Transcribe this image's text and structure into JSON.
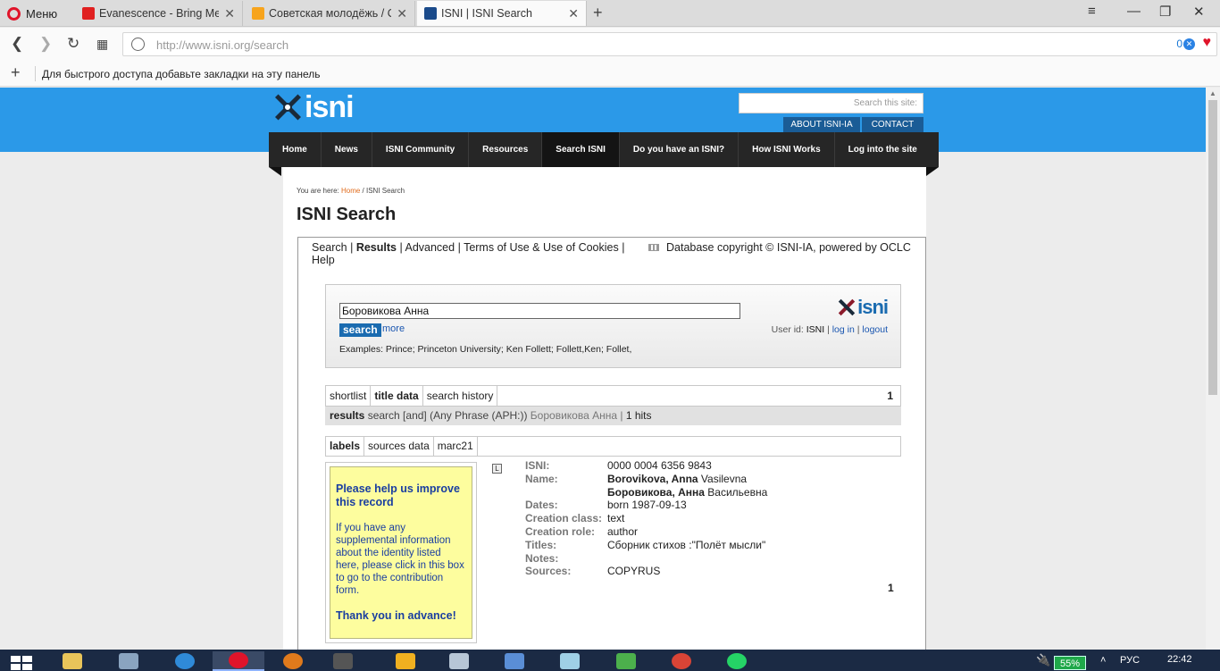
{
  "browser": {
    "menu_label": "Меню",
    "tabs": [
      {
        "title": "Evanescence - Bring Me To Life",
        "favicon_color": "#e02020"
      },
      {
        "title": "Советская молодёжь / Одноклассники",
        "favicon_color": "#f7a41d"
      },
      {
        "title": "ISNI | ISNI Search",
        "favicon_color": "#1a4a8a"
      }
    ],
    "url": "http://www.isni.org/search",
    "adblock_count": "0",
    "bookmarks_hint": "Для быстрого доступа добавьте закладки на эту панель"
  },
  "site": {
    "logo_text": "isni",
    "search_placeholder": "Search this site:",
    "top_buttons": [
      "ABOUT ISNI-IA",
      "CONTACT"
    ],
    "nav": [
      "Home",
      "News",
      "ISNI Community",
      "Resources",
      "Search ISNI",
      "Do you have an ISNI?",
      "How ISNI Works",
      "Log into the site"
    ],
    "nav_active": "Search ISNI",
    "breadcrumb": {
      "prefix": "You are here: ",
      "home": "Home",
      "sep": " / ",
      "current": "ISNI Search"
    },
    "page_title": "ISNI Search",
    "brand_color": "#2b99e8"
  },
  "search": {
    "links": {
      "search": "Search",
      "results": "Results",
      "advanced": "Advanced",
      "terms": "Terms of Use & Use of Cookies",
      "help": "Help"
    },
    "copyright": "Database copyright © ISNI-IA, powered by OCLC",
    "query": "Боровикова Анна",
    "search_button": "search",
    "more_link": "more",
    "examples": "Examples: Prince; Princeton University; Ken Follett; Follett,Ken; Follet,",
    "user_label": "User id: ",
    "user_id": "ISNI",
    "login": "log in",
    "logout": "logout",
    "logo_small": "isni"
  },
  "results": {
    "tabs": [
      "shortlist",
      "title data",
      "search history"
    ],
    "page_count": "1",
    "summary": {
      "label": "results",
      "mode": "search [and]",
      "index": "(Any Phrase (APH:))",
      "term": "Боровикова Анна",
      "sep": "|",
      "hits": "1 hits"
    },
    "view_tabs": [
      "labels",
      "sources data",
      "marc21"
    ]
  },
  "help_box": {
    "title": "Please help us improve this record",
    "text": "If you have any supplemental information about the identity listed here, please click in this box to go to the contribution form.",
    "thanks": "Thank you in advance!"
  },
  "record": {
    "labels": {
      "isni": "ISNI:",
      "name": "Name:",
      "dates": "Dates:",
      "creation_class": "Creation class:",
      "creation_role": "Creation role:",
      "titles": "Titles:",
      "notes": "Notes:",
      "sources": "Sources:"
    },
    "isni": "0000 0004 6356 9843",
    "name_latin_bold": "Borovikova, Anna",
    "name_latin_rest": "Vasilevna",
    "name_cyr_bold": "Боровикова, Анна",
    "name_cyr_rest": "Васильевна",
    "dates": "born 1987-09-13",
    "creation_class": "text",
    "creation_role": "author",
    "titles": "Сборник стихов :\"Полёт мысли\"",
    "notes": "",
    "sources": "COPYRUS",
    "page_count": "1"
  },
  "taskbar": {
    "battery": "55%",
    "lang": "РУС",
    "clock": "22:42"
  }
}
